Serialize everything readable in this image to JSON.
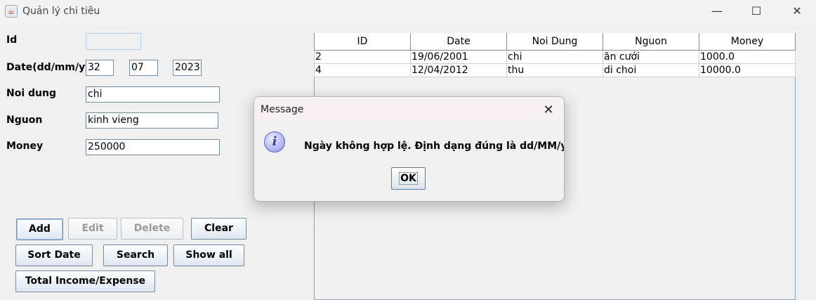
{
  "window": {
    "title": "Quản lý chi tiêu",
    "minimize_glyph": "—",
    "maximize_glyph": "☐",
    "close_glyph": "✕",
    "app_icon": "java-coffee-icon"
  },
  "form": {
    "id_label": "Id",
    "id_value": "",
    "date_label": "Date(dd/mm/yyyy)",
    "day_value": "32",
    "month_value": "07",
    "year_value": "2023",
    "noidung_label": "Noi dung",
    "noidung_value": "chi",
    "nguon_label": "Nguon",
    "nguon_value": "kinh vieng",
    "money_label": "Money",
    "money_value": "250000"
  },
  "buttons": {
    "add": "Add",
    "edit": "Edit",
    "delete": "Delete",
    "clear": "Clear",
    "sort_date": "Sort Date",
    "search": "Search",
    "show_all": "Show all",
    "total": "Total Income/Expense"
  },
  "table": {
    "columns": [
      "ID",
      "Date",
      "Noi Dung",
      "Nguon",
      "Money"
    ],
    "rows": [
      [
        "2",
        "19/06/2001",
        "chi",
        "ăn cưới",
        "1000.0"
      ],
      [
        "4",
        "12/04/2012",
        "thu",
        "di choi",
        "10000.0"
      ]
    ]
  },
  "dialog": {
    "title": "Message",
    "message": "Ngày không hợp lệ. Định dạng đúng là dd/MM/yyyy.",
    "ok_label": "OK",
    "icon": "info-icon",
    "close_glyph": "✕"
  }
}
